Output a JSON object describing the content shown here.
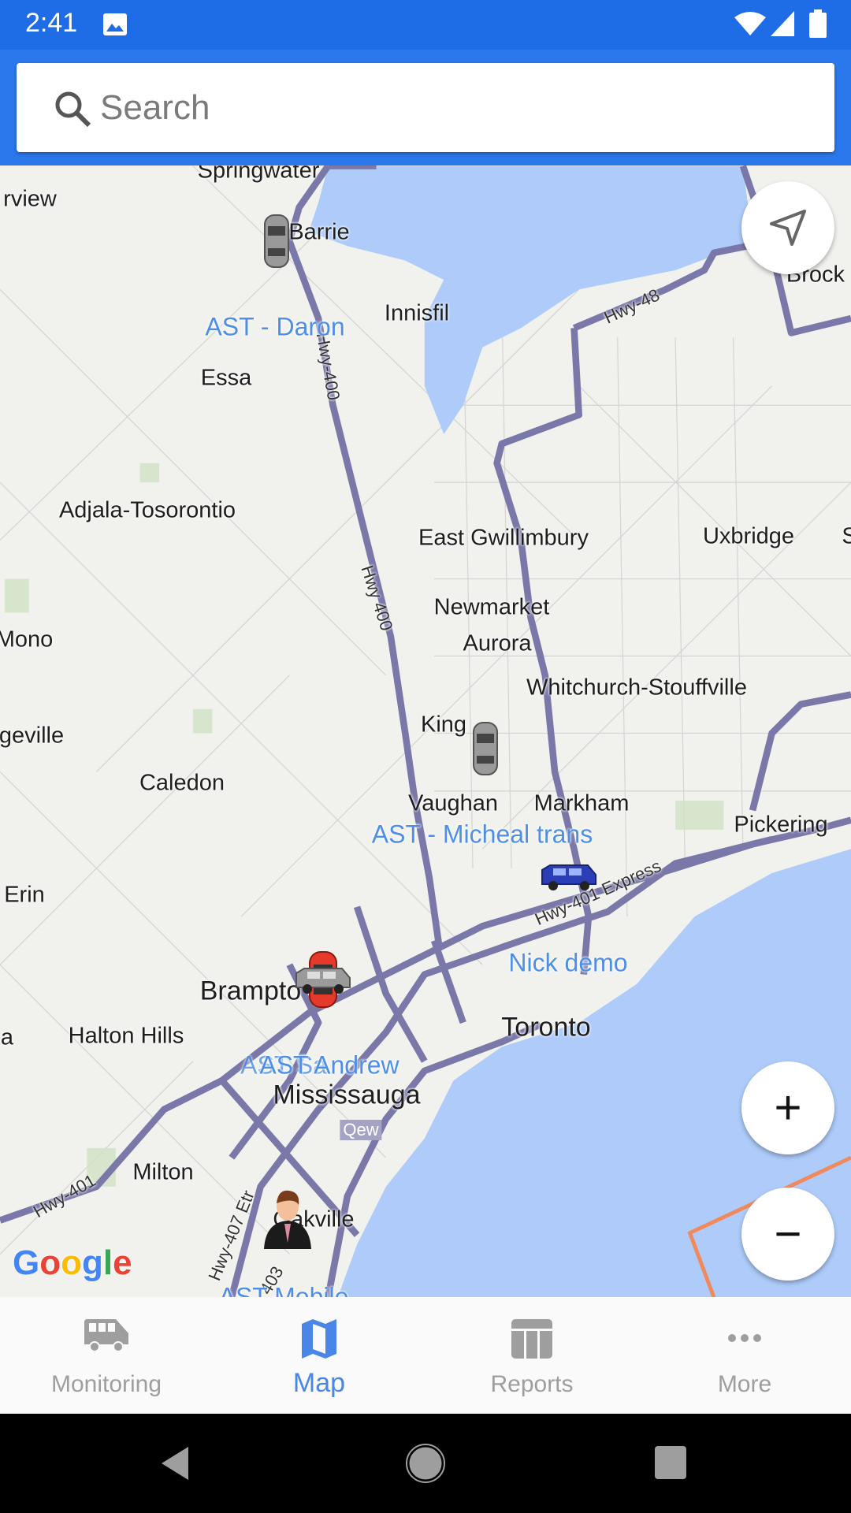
{
  "status_bar": {
    "time": "2:41",
    "icons": [
      "image-icon",
      "wifi-icon",
      "signal-icon",
      "battery-icon"
    ],
    "color": "#1e6de6"
  },
  "search": {
    "placeholder": "Search",
    "icon": "search-icon"
  },
  "map": {
    "places": [
      "Springwater",
      "rview",
      "Barrie",
      "Innisfil",
      "Essa",
      "Brock",
      "Adjala-Tosorontio",
      "East Gwillimbury",
      "Uxbridge",
      "Newmarket",
      "Aurora",
      "Mono",
      "Whitchurch-Stouffville",
      "geville",
      "King",
      "Caledon",
      "Vaughan",
      "Markham",
      "Pickering",
      "Erin",
      "Brampto",
      "Toronto",
      "Halton Hills",
      "a",
      "Mississauga",
      "Milton",
      "Oakville",
      "S"
    ],
    "roads": [
      "Hwy-400",
      "Hwy 400",
      "Hwy-48",
      "Hwy-401 Express",
      "Qew",
      "Hwy-401",
      "Hwy-407 Etr",
      "403"
    ],
    "vehicles": [
      "AST - Daron",
      "AST - Micheal trans",
      "Nick demo",
      "AST Andrew",
      "AST Mobile"
    ],
    "overlapping_label": "AST Sa",
    "attribution": "Google"
  },
  "controls": {
    "locate": "navigation-arrow-icon",
    "zoom_in": "+",
    "zoom_out": "−"
  },
  "bottom_nav": {
    "active": "Map",
    "active_color": "#4a86e8",
    "items": [
      {
        "label": "Monitoring",
        "icon": "bus-icon"
      },
      {
        "label": "Map",
        "icon": "map-icon"
      },
      {
        "label": "Reports",
        "icon": "table-icon"
      },
      {
        "label": "More",
        "icon": "more-icon"
      }
    ]
  }
}
